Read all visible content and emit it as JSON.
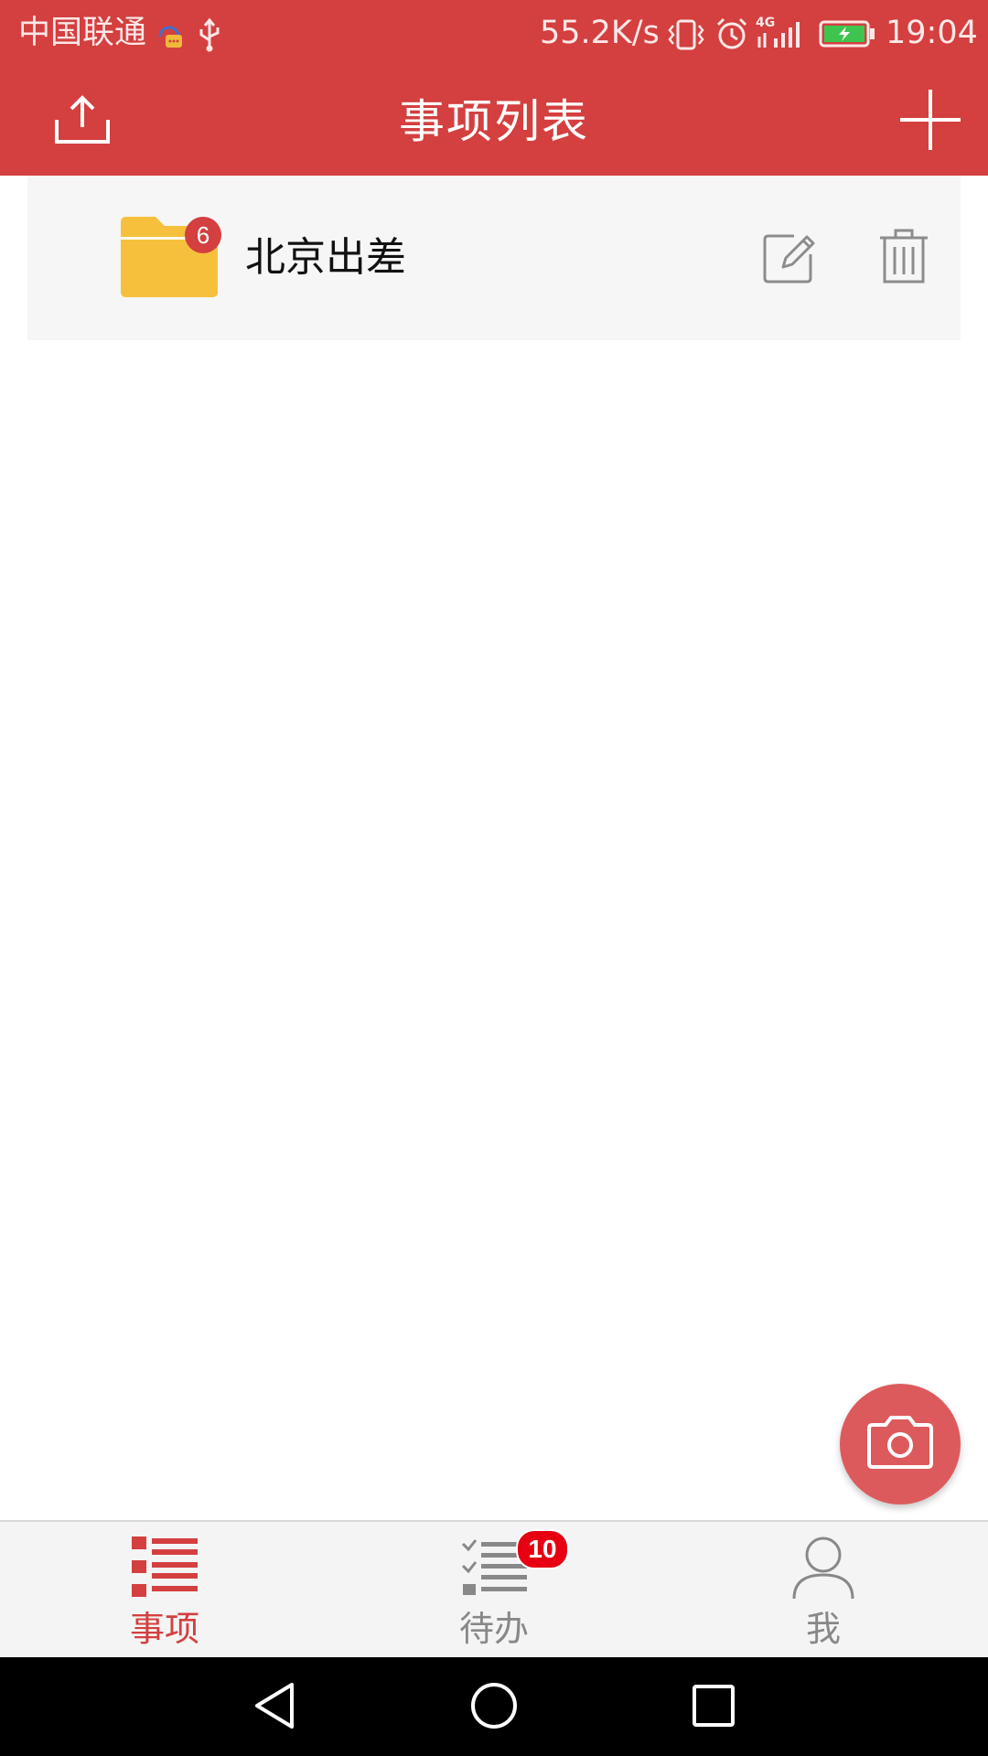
{
  "status_bar": {
    "carrier": "中国联通",
    "net_speed": "55.2K/s",
    "network_type": "4G",
    "time": "19:04",
    "icons": [
      "chat-notification-icon",
      "usb-icon",
      "vibrate-icon",
      "alarm-icon",
      "signal-icon",
      "battery-charging-icon"
    ]
  },
  "app_bar": {
    "title": "事项列表",
    "left_icon": "upload-icon",
    "right_icon": "add-icon"
  },
  "list": {
    "items": [
      {
        "label": "北京出差",
        "count": "6",
        "icon": "folder-icon",
        "actions": [
          "edit-icon",
          "trash-icon"
        ]
      }
    ]
  },
  "fab": {
    "icon": "camera-icon"
  },
  "tab_bar": {
    "tabs": [
      {
        "label": "事项",
        "icon": "list-icon",
        "active": true
      },
      {
        "label": "待办",
        "icon": "checklist-icon",
        "badge": "10",
        "active": false
      },
      {
        "label": "我",
        "icon": "person-icon",
        "active": false
      }
    ]
  },
  "nav_bar": {
    "buttons": [
      "back-icon",
      "home-icon",
      "recents-icon"
    ]
  },
  "colors": {
    "primary": "#d43f3f",
    "fab": "#dd5a5c",
    "folder": "#f7c03c",
    "badge_red": "#e60012",
    "tab_active": "#d43f3f",
    "tab_inactive": "#888888",
    "list_bg": "#f6f6f6"
  }
}
